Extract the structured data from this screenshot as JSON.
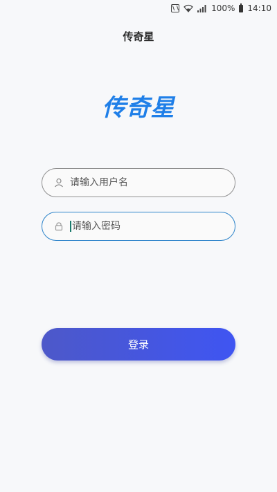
{
  "status_bar": {
    "battery": "100%",
    "time": "14:10"
  },
  "header": {
    "title": "传奇星"
  },
  "logo": {
    "text": "传奇星",
    "color": "#1f7fe8"
  },
  "form": {
    "username_placeholder": "请输入用户名",
    "password_placeholder": "请输入密码",
    "focused_field_border": "#2a82c9",
    "login_label": "登录"
  },
  "colors": {
    "button_gradient_start": "#4d58c9",
    "button_gradient_end": "#3f55f2",
    "background": "#f7f8fa"
  },
  "icons": {
    "user": "user-icon",
    "lock": "lock-icon"
  }
}
